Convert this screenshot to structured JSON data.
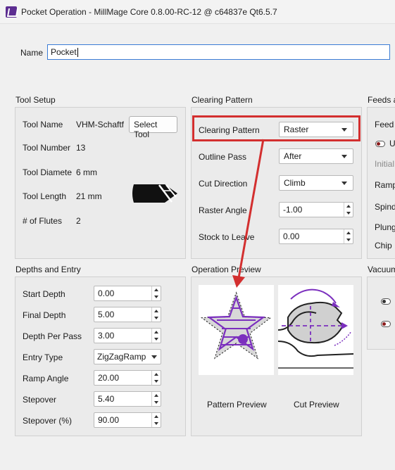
{
  "window": {
    "title": "Pocket Operation - MillMage Core 0.8.00-RC-12 @ c64837e Qt6.5.7"
  },
  "name_field": {
    "label": "Name",
    "value": "Pocket"
  },
  "tool_setup": {
    "title": "Tool Setup",
    "tool_name_label": "Tool Name",
    "tool_name_value": "VHM-Schaftf",
    "select_tool_label": "Select Tool",
    "tool_number_label": "Tool Number",
    "tool_number_value": "13",
    "tool_diameter_label": "Tool Diamete",
    "tool_diameter_value": "6 mm",
    "tool_length_label": "Tool Length",
    "tool_length_value": "21 mm",
    "flutes_label": "# of Flutes",
    "flutes_value": "2"
  },
  "clearing_pattern": {
    "title": "Clearing Pattern",
    "pattern_label": "Clearing Pattern",
    "pattern_value": "Raster",
    "outline_pass_label": "Outline Pass",
    "outline_pass_value": "After",
    "cut_direction_label": "Cut Direction",
    "cut_direction_value": "Climb",
    "raster_angle_label": "Raster Angle",
    "raster_angle_value": "-1.00",
    "stock_to_leave_label": "Stock to Leave",
    "stock_to_leave_value": "0.00"
  },
  "feeds": {
    "title": "Feeds a",
    "feed_label": "Feed",
    "toggle_label": "U",
    "initial_label": "Initial",
    "ramp_label": "Ramp",
    "spindle_label": "Spind",
    "plunge_label": "Plung",
    "chip_label": "Chip"
  },
  "depths_entry": {
    "title": "Depths and Entry",
    "start_depth_label": "Start Depth",
    "start_depth_value": "0.00",
    "final_depth_label": "Final Depth",
    "final_depth_value": "5.00",
    "depth_per_pass_label": "Depth Per Pass",
    "depth_per_pass_value": "3.00",
    "entry_type_label": "Entry Type",
    "entry_type_value": "ZigZagRamp",
    "ramp_angle_label": "Ramp Angle",
    "ramp_angle_value": "20.00",
    "stepover_label": "Stepover",
    "stepover_value": "5.40",
    "stepover_pct_label": "Stepover (%)",
    "stepover_pct_value": "90.00"
  },
  "operation_preview": {
    "title": "Operation Preview",
    "pattern_preview_label": "Pattern Preview",
    "cut_preview_label": "Cut Preview"
  },
  "vacuum": {
    "title": "Vacuum"
  },
  "colors": {
    "accent_purple": "#7b2fbe",
    "highlight_red": "#d32f2f",
    "focus_blue": "#3a7bd5"
  }
}
